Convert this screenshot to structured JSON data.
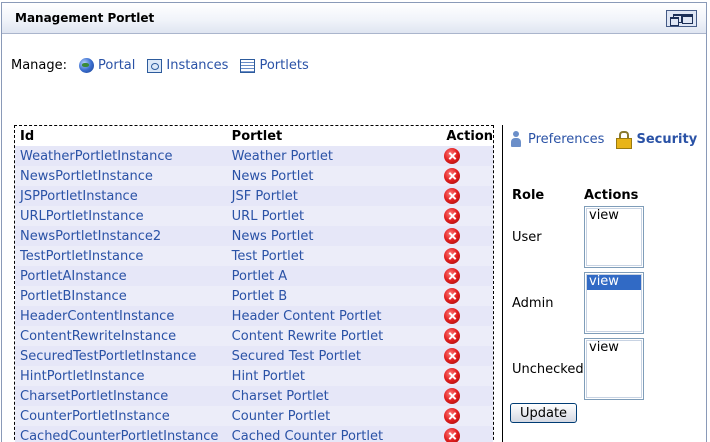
{
  "portlet": {
    "title": "Management Portlet"
  },
  "manage": {
    "label": "Manage:",
    "links": [
      {
        "label": "Portal",
        "icon": "globe-icon"
      },
      {
        "label": "Instances",
        "icon": "instances-icon"
      },
      {
        "label": "Portlets",
        "icon": "portlets-list-icon"
      }
    ]
  },
  "table": {
    "headers": {
      "id": "Id",
      "portlet": "Portlet",
      "action": "Action"
    },
    "rows": [
      {
        "id": "WeatherPortletInstance",
        "portlet": "Weather Portlet"
      },
      {
        "id": "NewsPortletInstance",
        "portlet": "News Portlet"
      },
      {
        "id": "JSPPortletInstance",
        "portlet": "JSF Portlet"
      },
      {
        "id": "URLPortletInstance",
        "portlet": "URL Portlet"
      },
      {
        "id": "NewsPortletInstance2",
        "portlet": "News Portlet"
      },
      {
        "id": "TestPortletInstance",
        "portlet": "Test Portlet"
      },
      {
        "id": "PortletAInstance",
        "portlet": "Portlet A"
      },
      {
        "id": "PortletBInstance",
        "portlet": "Portlet B"
      },
      {
        "id": "HeaderContentInstance",
        "portlet": "Header Content Portlet"
      },
      {
        "id": "ContentRewriteInstance",
        "portlet": "Content Rewrite Portlet"
      },
      {
        "id": "SecuredTestPortletInstance",
        "portlet": "Secured Test Portlet"
      },
      {
        "id": "HintPortletInstance",
        "portlet": "Hint Portlet"
      },
      {
        "id": "CharsetPortletInstance",
        "portlet": "Charset Portlet"
      },
      {
        "id": "CounterPortletInstance",
        "portlet": "Counter Portlet"
      },
      {
        "id": "CachedCounterPortletInstance",
        "portlet": "Cached Counter Portlet"
      }
    ]
  },
  "side": {
    "tabs": {
      "preferences": "Preferences",
      "security": "Security"
    },
    "headers": {
      "role": "Role",
      "actions": "Actions"
    },
    "roles": [
      {
        "name": "User",
        "options": [
          "view"
        ],
        "selected": false
      },
      {
        "name": "Admin",
        "options": [
          "view"
        ],
        "selected": true
      },
      {
        "name": "Unchecked",
        "options": [
          "view"
        ],
        "selected": false
      }
    ],
    "update_label": "Update"
  },
  "colors": {
    "link": "#2a52a6",
    "row_bg": "#e6e7f8",
    "selected": "#316ac5"
  }
}
